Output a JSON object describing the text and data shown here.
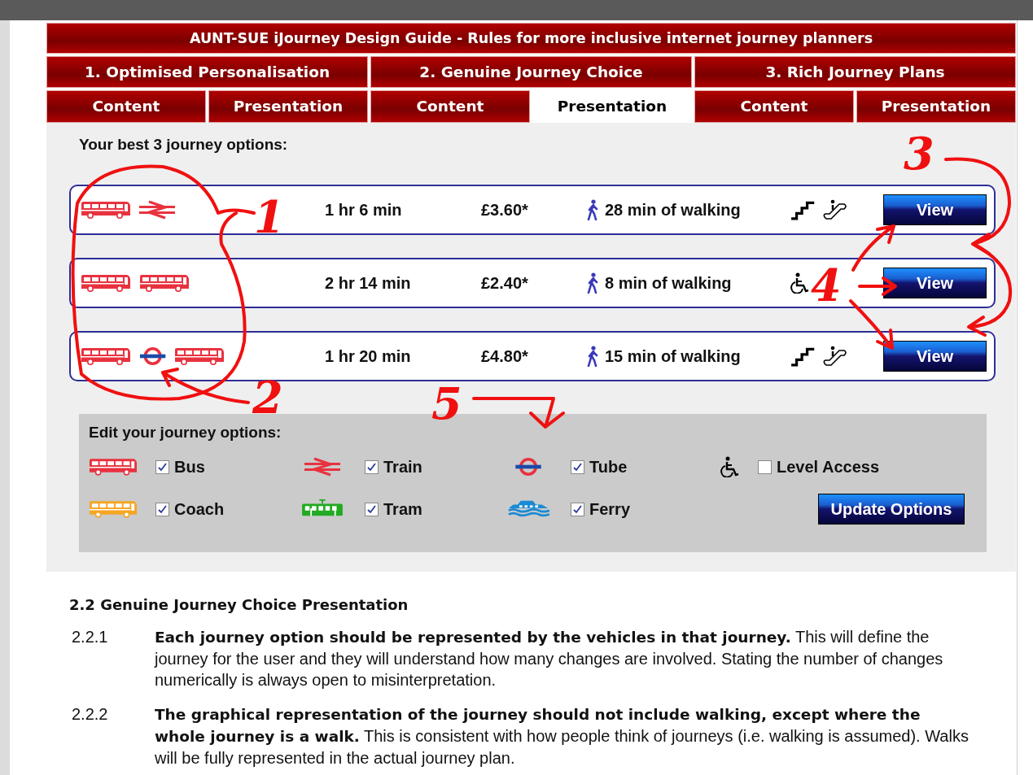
{
  "header": {
    "title": "AUNT-SUE iJourney Design Guide - Rules for more inclusive internet journey planners"
  },
  "sections": [
    {
      "label": "1. Optimised Personalisation",
      "tabs": [
        {
          "label": "Content",
          "selected": false
        },
        {
          "label": "Presentation",
          "selected": false
        }
      ]
    },
    {
      "label": "2. Genuine Journey Choice",
      "tabs": [
        {
          "label": "Content",
          "selected": false
        },
        {
          "label": "Presentation",
          "selected": true
        }
      ]
    },
    {
      "label": "3. Rich Journey Plans",
      "tabs": [
        {
          "label": "Content",
          "selected": false
        },
        {
          "label": "Presentation",
          "selected": false
        }
      ]
    }
  ],
  "journeys_heading": "Your best 3 journey options:",
  "journeys": [
    {
      "legs": [
        {
          "kind": "bus"
        },
        {
          "kind": "train"
        }
      ],
      "duration": "1 hr 6 min",
      "price": "£3.60*",
      "walking": "28 min of walking",
      "access": [
        {
          "kind": "stairs"
        },
        {
          "kind": "escalator"
        }
      ],
      "button": "View"
    },
    {
      "legs": [
        {
          "kind": "bus"
        },
        {
          "kind": "bus"
        }
      ],
      "duration": "2 hr 14 min",
      "price": "£2.40*",
      "walking": "8 min of walking",
      "access": [
        {
          "kind": "wheelchair"
        }
      ],
      "button": "View"
    },
    {
      "legs": [
        {
          "kind": "bus"
        },
        {
          "kind": "tube"
        },
        {
          "kind": "bus"
        }
      ],
      "duration": "1 hr 20 min",
      "price": "£4.80*",
      "walking": "15 min of walking",
      "access": [
        {
          "kind": "stairs"
        },
        {
          "kind": "escalator"
        }
      ],
      "button": "View"
    }
  ],
  "options": {
    "title": "Edit your journey options:",
    "items": [
      {
        "kind": "bus",
        "label": "Bus",
        "checked": true
      },
      {
        "kind": "train",
        "label": "Train",
        "checked": true
      },
      {
        "kind": "tube",
        "label": "Tube",
        "checked": true
      },
      {
        "kind": "wheelchair",
        "label": "Level Access",
        "checked": false
      },
      {
        "kind": "coach",
        "label": "Coach",
        "checked": true
      },
      {
        "kind": "tram",
        "label": "Tram",
        "checked": true
      },
      {
        "kind": "ferry",
        "label": "Ferry",
        "checked": true
      }
    ],
    "button": "Update Options"
  },
  "article": {
    "heading": "2.2 Genuine Journey Choice Presentation",
    "paragraphs": [
      {
        "number": "2.2.1",
        "text": "**Each journey option should be represented by the vehicles in that journey.** This will define the journey for the user and they will understand how many changes are involved. Stating the number of changes numerically is always open to misinterpretation."
      },
      {
        "number": "2.2.2",
        "text": "**The graphical representation of the journey should not include walking, except where the whole journey is a walk.** This is consistent with how people think of journeys (i.e. walking is assumed). Walks will be fully represented in the actual journey plan."
      }
    ]
  },
  "annotations": [
    {
      "label": "1"
    },
    {
      "label": "2"
    },
    {
      "label": "3"
    },
    {
      "label": "4"
    },
    {
      "label": "5"
    }
  ]
}
